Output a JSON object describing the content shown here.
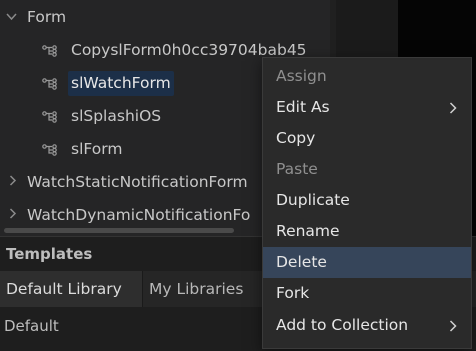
{
  "tree": {
    "parent_label": "Form",
    "items": [
      {
        "label": "CopyslForm0h0cc39704bab45"
      },
      {
        "label": "slWatchForm"
      },
      {
        "label": "slSplashiOS"
      },
      {
        "label": "slForm"
      }
    ],
    "groups": [
      {
        "label": "WatchStaticNotificationForm"
      },
      {
        "label": "WatchDynamicNotificationFo"
      }
    ]
  },
  "context_menu": {
    "items": [
      {
        "label": "Assign",
        "disabled": true
      },
      {
        "label": "Edit As",
        "submenu": true
      },
      {
        "label": "Copy"
      },
      {
        "label": "Paste",
        "disabled": true
      },
      {
        "label": "Duplicate"
      },
      {
        "label": "Rename"
      },
      {
        "label": "Delete",
        "highlighted": true
      },
      {
        "label": "Fork"
      },
      {
        "label": "Add to Collection",
        "submenu": true
      }
    ]
  },
  "templates": {
    "title": "Templates",
    "tabs": [
      {
        "label": "Default Library",
        "active": true
      },
      {
        "label": "My Libraries",
        "active": false
      }
    ],
    "library_name": "Default"
  },
  "colors": {
    "selection": "#1c2f48",
    "menu_highlight": "#36455a",
    "panel_bg": "#252526"
  }
}
